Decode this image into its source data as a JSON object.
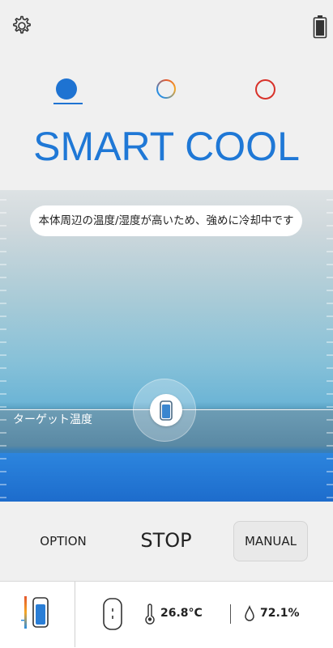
{
  "header": {
    "settings_icon": "gear-icon",
    "battery_icon": "battery-icon"
  },
  "modes": {
    "items": [
      {
        "name": "cool-mode",
        "color": "#1e73d2",
        "selected": true
      },
      {
        "name": "auto-mode",
        "colors": [
          "#2a8de0",
          "#e4572e"
        ],
        "selected": false
      },
      {
        "name": "warm-mode",
        "color": "#d8322a",
        "selected": false
      }
    ],
    "title": "SMART COOL"
  },
  "gauge": {
    "message": "本体周辺の温度/湿度が高いため、強めに冷却中です",
    "target_label": "ターゲット温度",
    "accent": "#1f78d6"
  },
  "controls": {
    "option_label": "OPTION",
    "stop_label": "STOP",
    "manual_label": "MANUAL"
  },
  "status": {
    "temperature": "26.8°C",
    "humidity": "72.1%",
    "device_icon": "device-icon",
    "thermometer_icon": "thermometer-icon",
    "droplet_icon": "droplet-icon"
  }
}
